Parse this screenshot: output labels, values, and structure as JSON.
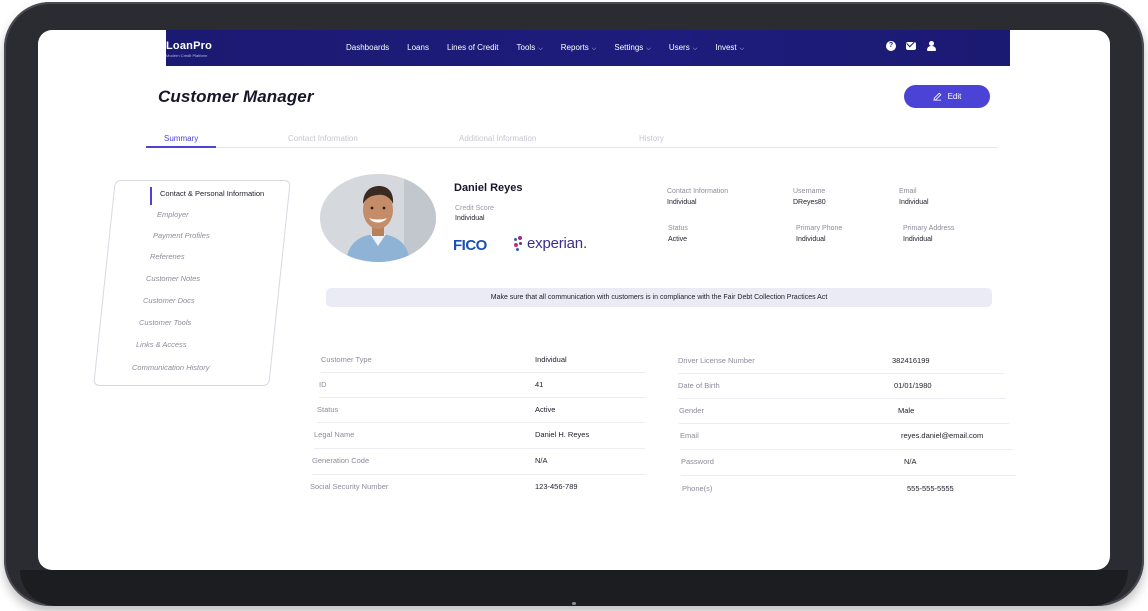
{
  "app": {
    "logo_main": "LoanPro",
    "logo_sub": "Modern Credit Platform"
  },
  "nav": [
    {
      "label": "Dashboards",
      "dropdown": false
    },
    {
      "label": "Loans",
      "dropdown": false
    },
    {
      "label": "Lines of Credit",
      "dropdown": false
    },
    {
      "label": "Tools",
      "dropdown": true
    },
    {
      "label": "Reports",
      "dropdown": true
    },
    {
      "label": "Settings",
      "dropdown": true
    },
    {
      "label": "Users",
      "dropdown": true
    },
    {
      "label": "Invest",
      "dropdown": true
    }
  ],
  "top_icons": [
    "help-icon",
    "mail-icon",
    "user-icon"
  ],
  "page": {
    "title": "Customer Manager",
    "edit_label": "Edit"
  },
  "tabs": [
    "Summary",
    "Contact Information",
    "Additional Information",
    "History"
  ],
  "sidebar": [
    "Contact & Personal Information",
    "Employer",
    "Payment Profiles",
    "Referenes",
    "Customer Notes",
    "Customer Docs",
    "Customer Tools",
    "Links & Access",
    "Communication History"
  ],
  "profile": {
    "name": "Daniel Reyes",
    "credit_score_label": "Credit Score",
    "credit_score_value": "Individual",
    "fico": "FICO",
    "experian": "experian."
  },
  "meta": {
    "contact_information_label": "Contact Information",
    "contact_information_value": "Individual",
    "username_label": "Username",
    "username_value": "DReyes80",
    "email_label": "Email",
    "email_value": "Individual",
    "status_label": "Status",
    "status_value": "Active",
    "primary_phone_label": "Primary Phone",
    "primary_phone_value": "Individual",
    "primary_address_label": "Primary Address",
    "primary_address_value": "Individual"
  },
  "notice": "Make sure that all communication with customers is in compliance with the Fair Debt Collection Practices Act",
  "details_left": [
    {
      "label": "Customer Type",
      "value": "Individual"
    },
    {
      "label": "ID",
      "value": "41"
    },
    {
      "label": "Status",
      "value": "Active"
    },
    {
      "label": "Legal Name",
      "value": "Daniel H. Reyes"
    },
    {
      "label": "Generation Code",
      "value": "N/A"
    },
    {
      "label": "Social Security Number",
      "value": "123-456-789"
    }
  ],
  "details_right": [
    {
      "label": "Driver License Number",
      "value": "382416199"
    },
    {
      "label": "Date of Birth",
      "value": "01/01/1980"
    },
    {
      "label": "Gender",
      "value": "Male"
    },
    {
      "label": "Email",
      "value": "reyes.daniel@email.com"
    },
    {
      "label": "Password",
      "value": "N/A"
    },
    {
      "label": "Phone(s)",
      "value": "555-555-5555"
    }
  ],
  "colors": {
    "topbar": "#1b1a72",
    "accent": "#4b43d6",
    "notice_bg": "#ebebf6",
    "fico": "#1a4fb3",
    "experian": "#3d2d8a"
  }
}
